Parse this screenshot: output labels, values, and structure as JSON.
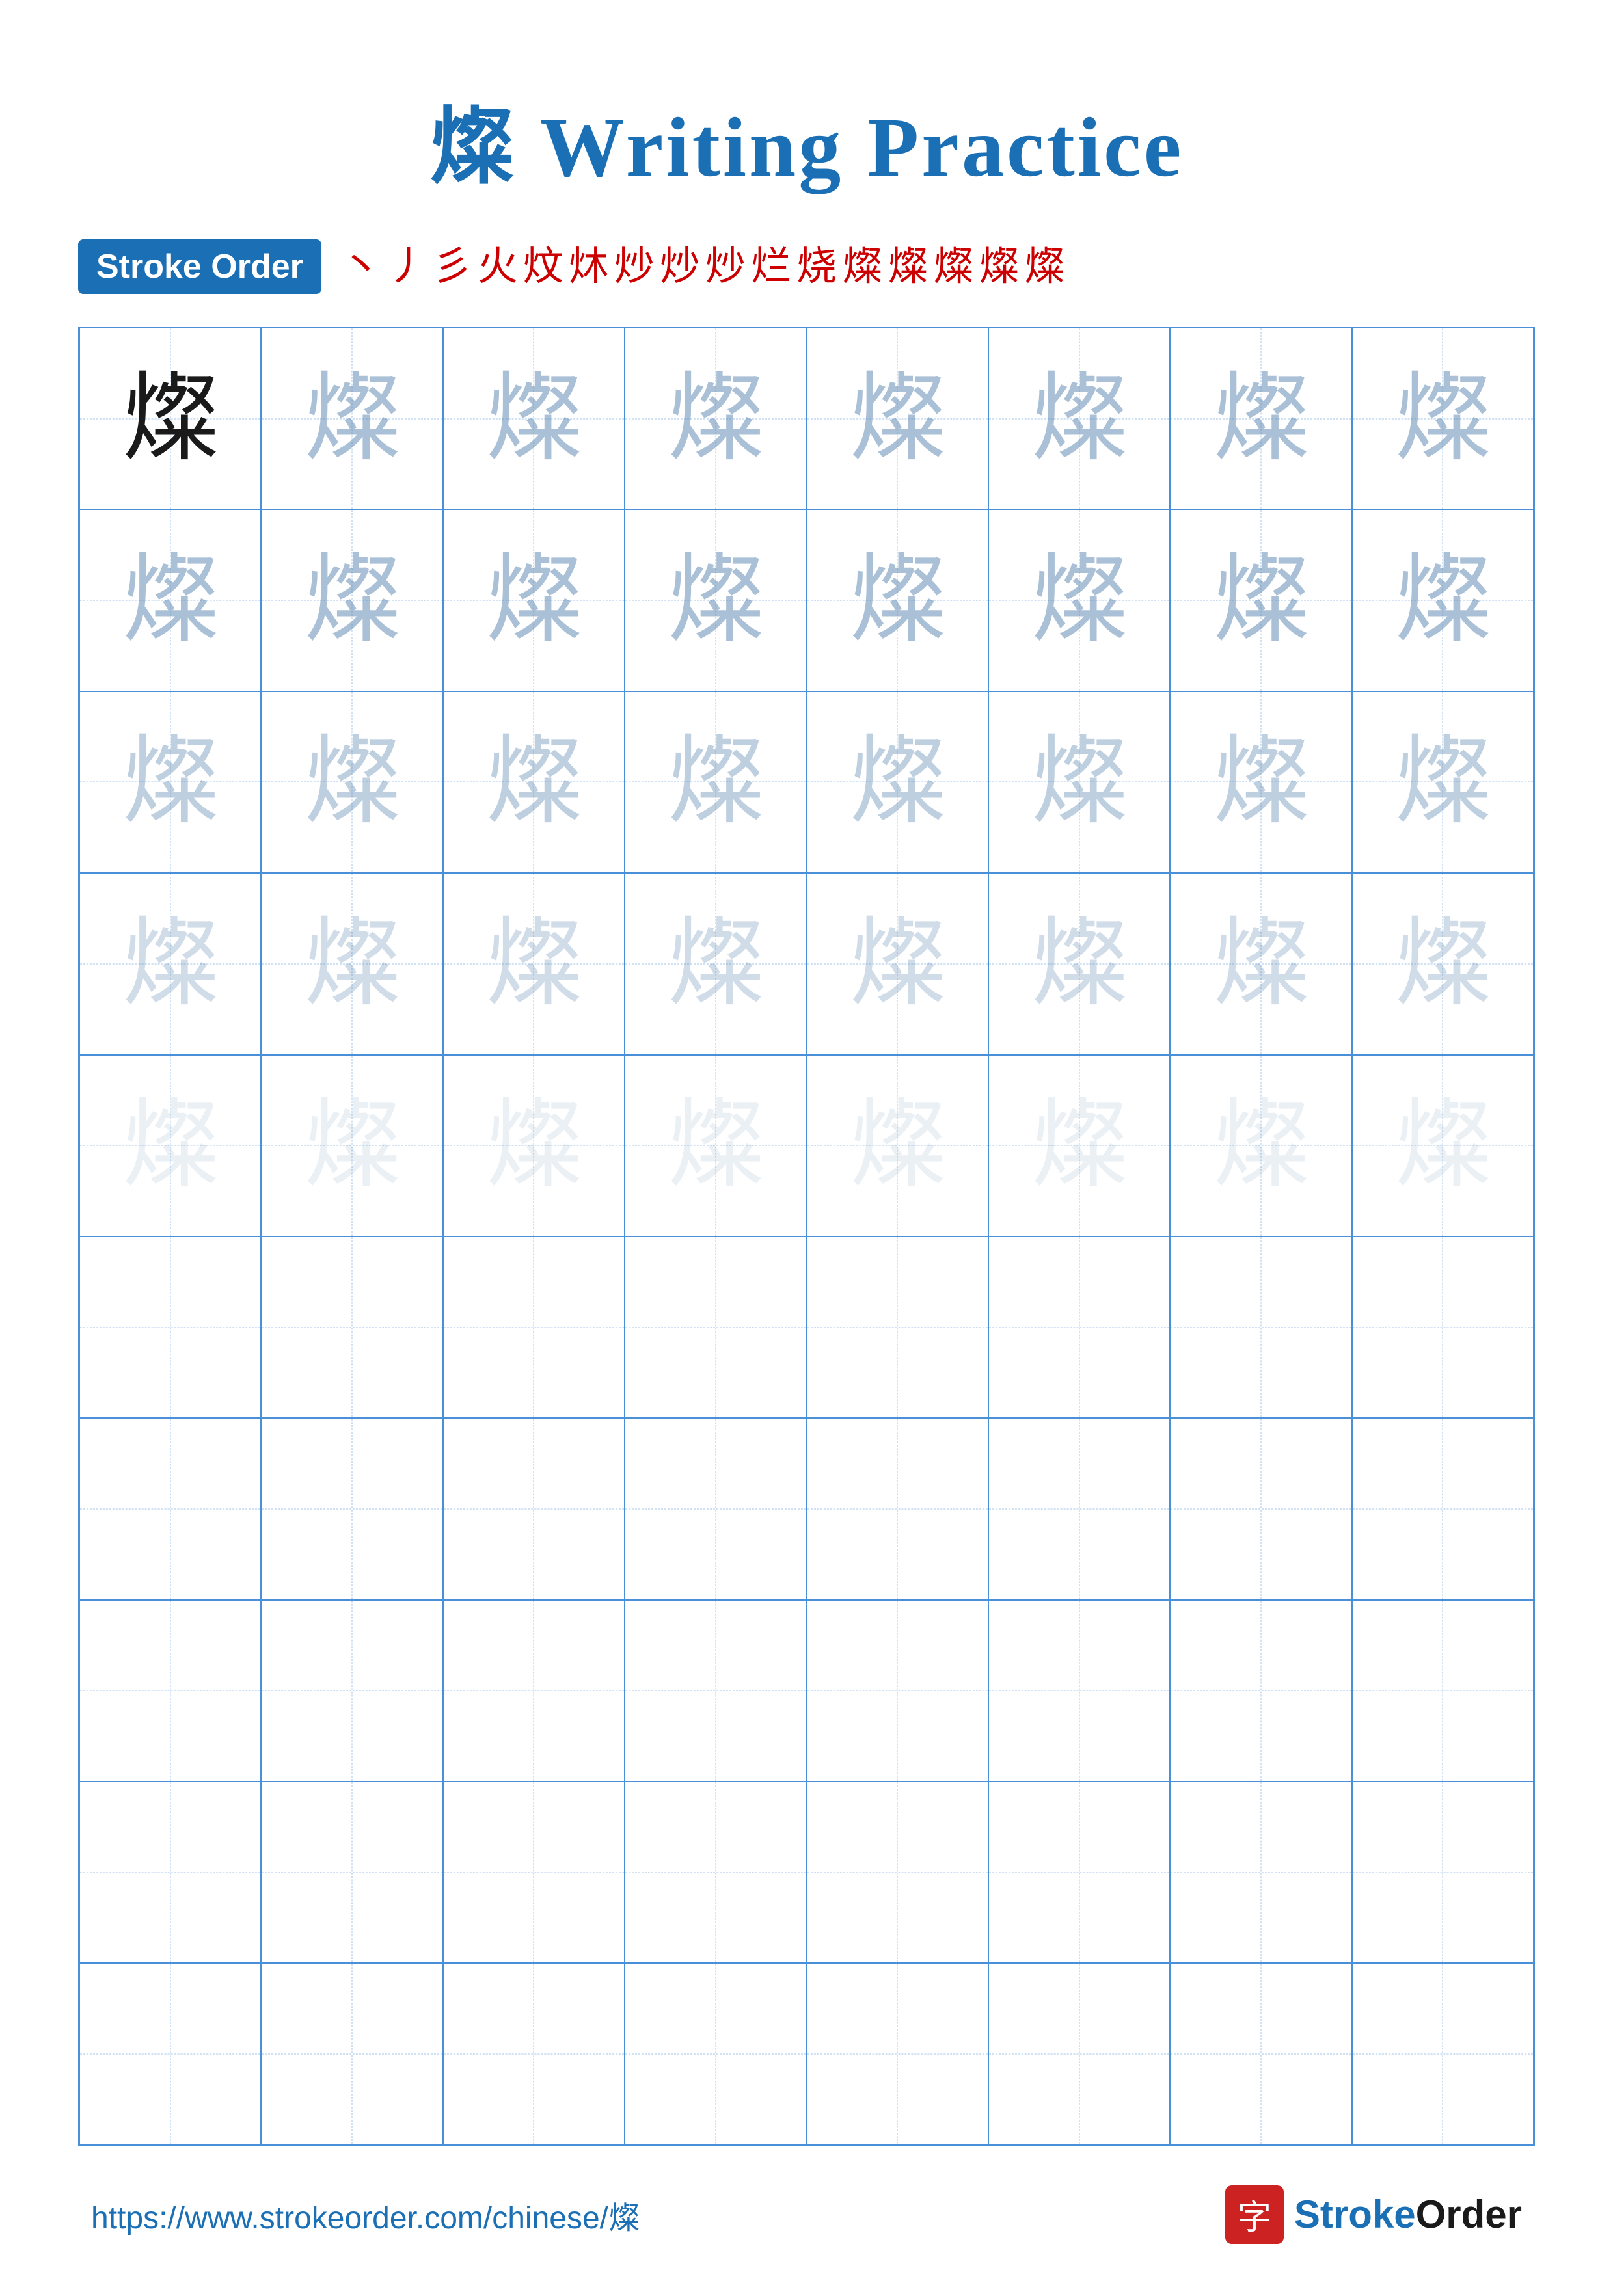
{
  "page": {
    "title": "燦 Writing Practice",
    "character": "燦",
    "title_label": "Writing Practice"
  },
  "stroke_order": {
    "badge_label": "Stroke Order",
    "strokes": [
      "丶",
      "丿",
      "彡",
      "火",
      "炆",
      "炑",
      "炒",
      "炒",
      "炒",
      "烂",
      "烧",
      "燦",
      "燦",
      "燦",
      "燦",
      "燦"
    ]
  },
  "grid": {
    "rows": 10,
    "cols": 8,
    "character": "燦"
  },
  "footer": {
    "url": "https://www.strokeorder.com/chinese/燦",
    "brand_char": "字",
    "brand_name": "StrokeOrder"
  }
}
